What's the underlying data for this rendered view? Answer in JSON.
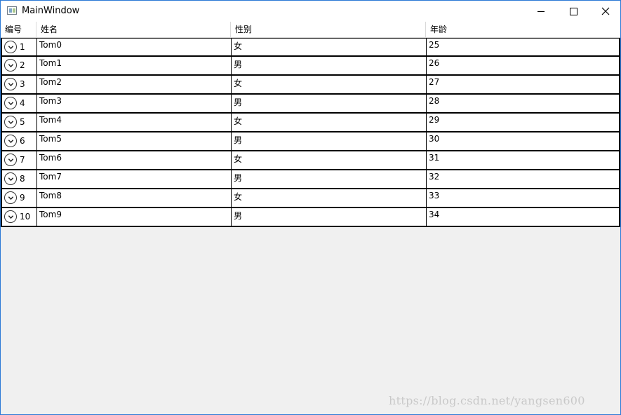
{
  "window": {
    "title": "MainWindow",
    "icon": "app-window-icon",
    "controls": {
      "minimize_icon": "minimize-icon",
      "maximize_icon": "maximize-icon",
      "close_icon": "close-icon"
    }
  },
  "grid": {
    "columns": [
      "编号",
      "姓名",
      "性别",
      "年龄"
    ],
    "rows": [
      {
        "id": "1",
        "name": "Tom0",
        "gender": "女",
        "age": "25"
      },
      {
        "id": "2",
        "name": "Tom1",
        "gender": "男",
        "age": "26"
      },
      {
        "id": "3",
        "name": "Tom2",
        "gender": "女",
        "age": "27"
      },
      {
        "id": "4",
        "name": "Tom3",
        "gender": "男",
        "age": "28"
      },
      {
        "id": "5",
        "name": "Tom4",
        "gender": "女",
        "age": "29"
      },
      {
        "id": "6",
        "name": "Tom5",
        "gender": "男",
        "age": "30"
      },
      {
        "id": "7",
        "name": "Tom6",
        "gender": "女",
        "age": "31"
      },
      {
        "id": "8",
        "name": "Tom7",
        "gender": "男",
        "age": "32"
      },
      {
        "id": "9",
        "name": "Tom8",
        "gender": "女",
        "age": "33"
      },
      {
        "id": "10",
        "name": "Tom9",
        "gender": "男",
        "age": "34"
      }
    ],
    "expander_icon": "chevron-down-circle-icon"
  },
  "watermark": "https://blog.csdn.net/yangsen600",
  "colors": {
    "window_border": "#2b79d6",
    "background": "#f0f0f0",
    "row_border": "#000000"
  }
}
